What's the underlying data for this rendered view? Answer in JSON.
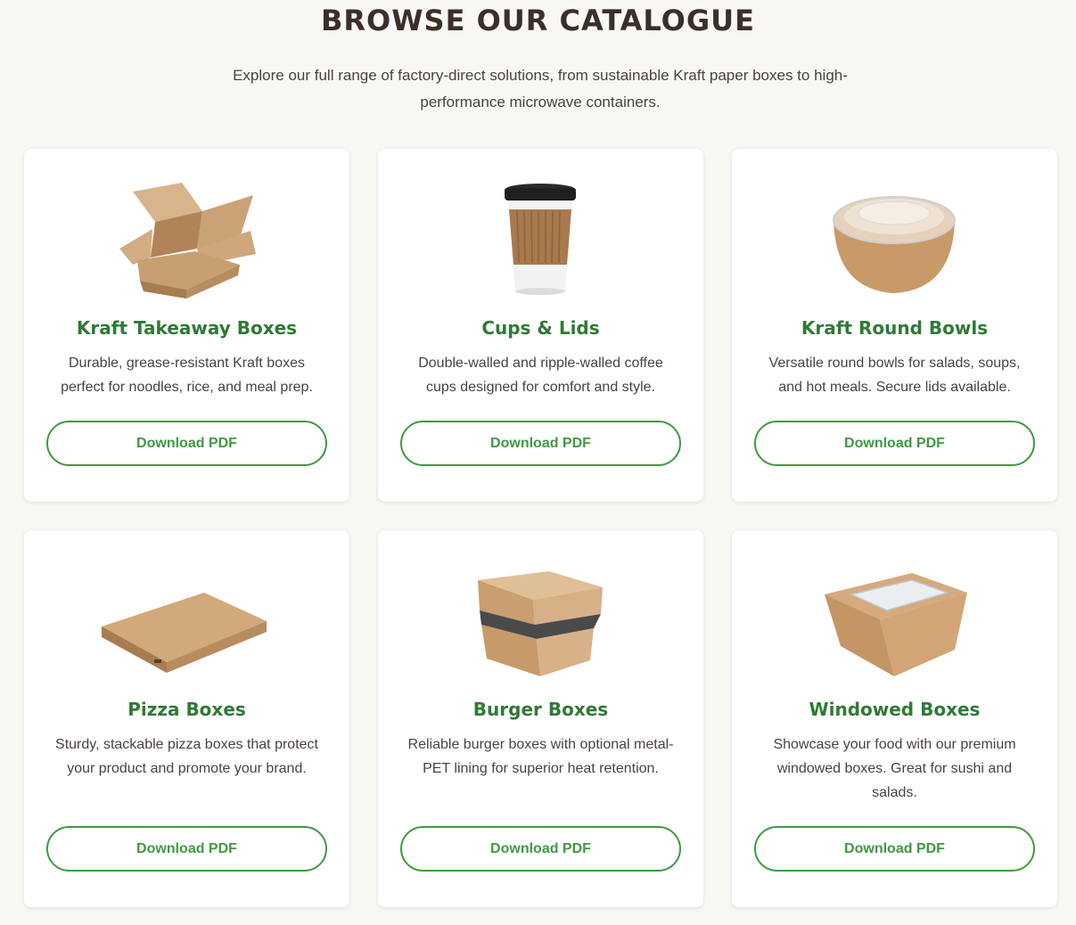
{
  "header": {
    "title": "BROWSE OUR CATALOGUE",
    "subtitle": "Explore our full range of factory-direct solutions, from sustainable Kraft paper boxes to high-performance microwave containers."
  },
  "colors": {
    "accent": "#3f9a42",
    "title_green": "#2f7a36",
    "heading_brown": "#3b2f29",
    "kraft": "#c8a27a"
  },
  "products": [
    {
      "title": "Kraft Takeaway Boxes",
      "description": "Durable, grease-resistant Kraft boxes perfect for noodles, rice, and meal prep.",
      "button": "Download PDF",
      "icon": "kraft-takeaway-box-image"
    },
    {
      "title": "Cups & Lids",
      "description": "Double-walled and ripple-walled coffee cups designed for comfort and style.",
      "button": "Download PDF",
      "icon": "coffee-cup-image"
    },
    {
      "title": "Kraft Round Bowls",
      "description": "Versatile round bowls for salads, soups, and hot meals. Secure lids available.",
      "button": "Download PDF",
      "icon": "kraft-round-bowl-image"
    },
    {
      "title": "Pizza Boxes",
      "description": "Sturdy, stackable pizza boxes that protect your product and promote your brand.",
      "button": "Download PDF",
      "icon": "pizza-box-image"
    },
    {
      "title": "Burger Boxes",
      "description": "Reliable burger boxes with optional metal-PET lining for superior heat retention.",
      "button": "Download PDF",
      "icon": "burger-box-image"
    },
    {
      "title": "Windowed Boxes",
      "description": "Showcase your food with our premium windowed boxes. Great for sushi and salads.",
      "button": "Download PDF",
      "icon": "windowed-box-image"
    }
  ]
}
